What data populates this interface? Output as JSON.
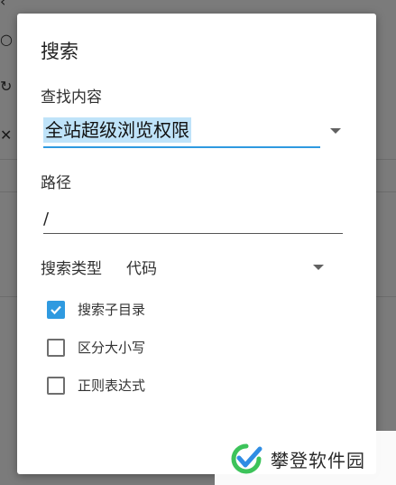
{
  "dialog": {
    "title": "搜索",
    "query_label": "查找内容",
    "query_value": "全站超级浏览权限",
    "path_label": "路径",
    "path_value": "/",
    "search_type_label": "搜索类型",
    "search_type_value": "代码",
    "options": [
      {
        "label": "搜索子目录",
        "checked": true
      },
      {
        "label": "区分大小写",
        "checked": false
      },
      {
        "label": "正则表达式",
        "checked": false
      }
    ]
  },
  "watermark": {
    "text": "攀登软件园"
  },
  "colors": {
    "accent": "#2f9ae0",
    "selection": "#bfe3f9",
    "watermark_green": "#3cc35a",
    "watermark_blue": "#2f8de4"
  }
}
